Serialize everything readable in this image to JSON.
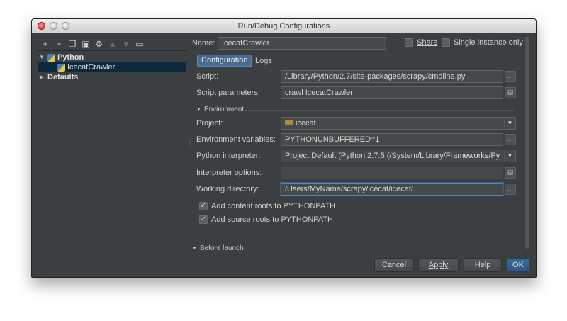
{
  "window": {
    "title": "Run/Debug Configurations"
  },
  "tree": {
    "items": [
      {
        "label": "Python"
      },
      {
        "label": "IcecatCrawler"
      },
      {
        "label": "Defaults"
      }
    ]
  },
  "toolbar": {
    "add": "+",
    "remove": "−",
    "copy": "❐",
    "save": "▣",
    "edit": "⚙",
    "up": "▲",
    "down": "▼",
    "folder": "▭"
  },
  "name": {
    "label": "Name:",
    "value": "IcecatCrawler"
  },
  "share": {
    "label": "Share",
    "checked": false
  },
  "single_instance": {
    "label": "Single instance only",
    "checked": false
  },
  "tabs": [
    {
      "label": "Configuration",
      "selected": true
    },
    {
      "label": "Logs",
      "selected": false
    }
  ],
  "form": {
    "script": {
      "label": "Script:",
      "value": "/Library/Python/2.7/site-packages/scrapy/cmdline.py"
    },
    "script_params": {
      "label": "Script parameters:",
      "value": "crawl IcecatCrawler"
    },
    "environment_section": "Environment",
    "project": {
      "label": "Project:",
      "value": "icecat"
    },
    "env_vars": {
      "label": "Environment variables:",
      "value": "PYTHONUNBUFFERED=1"
    },
    "interpreter": {
      "label": "Python interpreter:",
      "value": "Project Default (Python 2.7.5 (/System/Library/Frameworks/Py"
    },
    "interpreter_options": {
      "label": "Interpreter options:",
      "value": ""
    },
    "working_dir": {
      "label": "Working directory:",
      "value": "/Users/MyName/scrapy/icecat/icecat/"
    },
    "content_roots": {
      "label": "Add content roots to PYTHONPATH",
      "checked": true
    },
    "source_roots": {
      "label": "Add source roots to PYTHONPATH",
      "checked": true
    },
    "before_launch": "Before launch"
  },
  "buttons": {
    "cancel": "Cancel",
    "apply": "Apply",
    "help": "Help",
    "ok": "OK"
  },
  "glyphs": {
    "check": "✓",
    "tri_down": "▼",
    "tri_right": "▶",
    "ellipsis": "…",
    "expand": "▤",
    "grip": "⋮"
  },
  "colors": {
    "accent": "#4a6b8f",
    "selection": "#0d293e",
    "background": "#3c3f41"
  }
}
